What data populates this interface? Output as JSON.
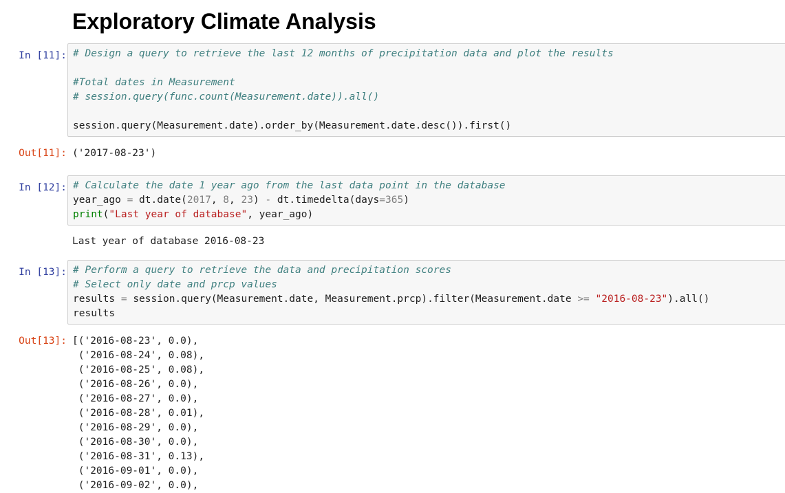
{
  "notebook": {
    "heading": "Exploratory Climate Analysis",
    "cell_11": {
      "in_prompt": "In [11]:",
      "comment_query": "# Design a query to retrieve the last 12 months of precipitation data and plot the results",
      "comment_total": "#Total dates in Measurement",
      "comment_count": "# session.query(func.count(Measurement.date)).all()",
      "code_query": "session.query(Measurement.date).order_by(Measurement.date.desc()).first()",
      "out_prompt": "Out[11]:",
      "output": "('2017-08-23')"
    },
    "cell_12": {
      "in_prompt": "In [12]:",
      "comment": "# Calculate the date 1 year ago from the last data point in the database",
      "l2": {
        "a": "year_ago",
        "eq": " = ",
        "b": "dt.date(",
        "n1": "2017",
        "c1": ", ",
        "n2": "8",
        "c2": ", ",
        "n3": "23",
        "d": ") ",
        "minus": "-",
        "e": " dt.timedelta(days",
        "eq2": "=",
        "n4": "365",
        "f": ")"
      },
      "l3": {
        "print": "print",
        "open": "(",
        "str": "\"Last year of database\"",
        "rest": ", year_ago)"
      },
      "output": "Last year of database 2016-08-23"
    },
    "cell_13": {
      "in_prompt": "In [13]:",
      "comment1": "# Perform a query to retrieve the data and precipitation scores",
      "comment2": "# Select only date and prcp values",
      "l3": {
        "a": "results",
        "eq": " = ",
        "b": "session.query(Measurement.date, Measurement.prcp).filter(Measurement.date ",
        "ge": ">=",
        "sp": " ",
        "str": "\"2016-08-23\"",
        "c": ").all()"
      },
      "l4": "results",
      "out_prompt": "Out[13]:",
      "output_lines": [
        "[('2016-08-23', 0.0),",
        " ('2016-08-24', 0.08),",
        " ('2016-08-25', 0.08),",
        " ('2016-08-26', 0.0),",
        " ('2016-08-27', 0.0),",
        " ('2016-08-28', 0.01),",
        " ('2016-08-29', 0.0),",
        " ('2016-08-30', 0.0),",
        " ('2016-08-31', 0.13),",
        " ('2016-09-01', 0.0),",
        " ('2016-09-02', 0.0),"
      ]
    }
  }
}
